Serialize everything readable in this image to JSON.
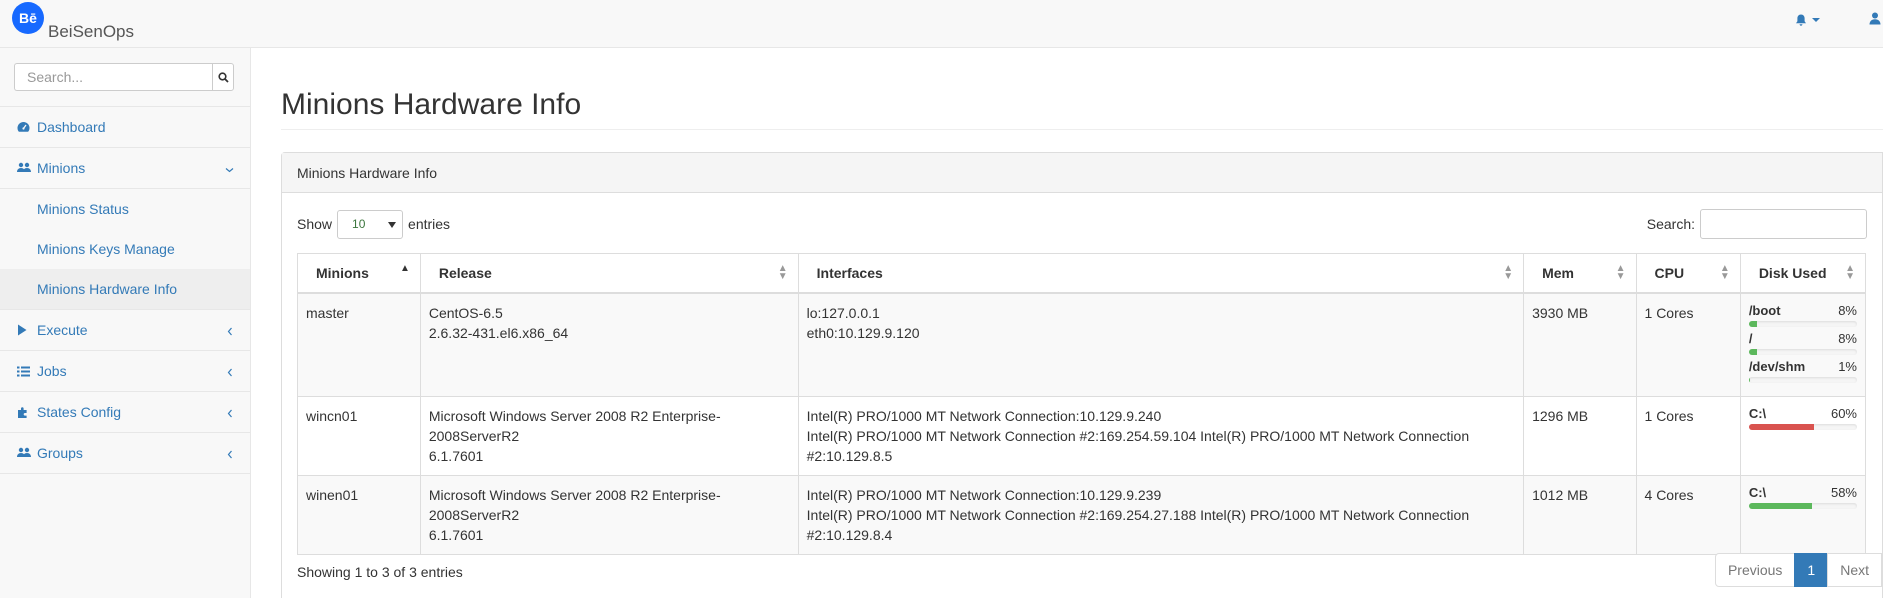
{
  "brand": {
    "logo_text": "Bē",
    "name": "BeiSenOps",
    "logo_color": "#1769ff"
  },
  "navbar": {
    "bell_icon": "bell-icon",
    "user_icon": "user-icon"
  },
  "sidebar": {
    "search_placeholder": "Search...",
    "items": [
      {
        "label": "Dashboard",
        "icon": "dashboard-icon"
      },
      {
        "label": "Minions",
        "icon": "users-icon",
        "expanded": true,
        "children": [
          {
            "label": "Minions Status"
          },
          {
            "label": "Minions Keys Manage"
          },
          {
            "label": "Minions Hardware Info",
            "active": true
          }
        ]
      },
      {
        "label": "Execute",
        "icon": "play-icon"
      },
      {
        "label": "Jobs",
        "icon": "list-icon"
      },
      {
        "label": "States Config",
        "icon": "puzzle-icon"
      },
      {
        "label": "Groups",
        "icon": "users-icon"
      }
    ]
  },
  "main": {
    "page_title": "Minions Hardware Info",
    "panel_heading": "Minions Hardware Info",
    "show_label": "Show",
    "entries_value": "10",
    "entries_label": "entries",
    "search_label": "Search:",
    "columns": [
      "Minions",
      "Release",
      "Interfaces",
      "Mem",
      "CPU",
      "Disk Used"
    ],
    "rows": [
      {
        "minion": "master",
        "release": [
          "CentOS-6.5",
          "2.6.32-431.el6.x86_64"
        ],
        "interfaces": [
          "lo:127.0.0.1",
          "eth0:10.129.9.120"
        ],
        "mem": "3930 MB",
        "cpu": "1 Cores",
        "disks": [
          {
            "mount": "/boot",
            "pct": "8%",
            "value": 8,
            "color": "#5cb85c"
          },
          {
            "mount": "/",
            "pct": "8%",
            "value": 8,
            "color": "#5cb85c"
          },
          {
            "mount": "/dev/shm",
            "pct": "1%",
            "value": 1,
            "color": "#5cb85c"
          }
        ]
      },
      {
        "minion": "wincn01",
        "release": [
          "Microsoft Windows Server 2008 R2 Enterprise-",
          "2008ServerR2",
          "6.1.7601"
        ],
        "interfaces": [
          "Intel(R) PRO/1000 MT Network Connection:10.129.9.240",
          "Intel(R) PRO/1000 MT Network Connection #2:169.254.59.104 Intel(R) PRO/1000 MT Network Connection",
          "#2:10.129.8.5"
        ],
        "mem": "1296 MB",
        "cpu": "1 Cores",
        "disks": [
          {
            "mount": "C:\\",
            "pct": "60%",
            "value": 60,
            "color": "#d9534f"
          }
        ]
      },
      {
        "minion": "winen01",
        "release": [
          "Microsoft Windows Server 2008 R2 Enterprise-",
          "2008ServerR2",
          "6.1.7601"
        ],
        "interfaces": [
          "Intel(R) PRO/1000 MT Network Connection:10.129.9.239",
          "Intel(R) PRO/1000 MT Network Connection #2:169.254.27.188 Intel(R) PRO/1000 MT Network Connection",
          "#2:10.129.8.4"
        ],
        "mem": "1012 MB",
        "cpu": "4 Cores",
        "disks": [
          {
            "mount": "C:\\",
            "pct": "58%",
            "value": 58,
            "color": "#5cb85c"
          }
        ]
      }
    ],
    "info": "Showing 1 to 3 of 3 entries",
    "pagination": {
      "previous": "Previous",
      "current": "1",
      "next": "Next"
    }
  }
}
